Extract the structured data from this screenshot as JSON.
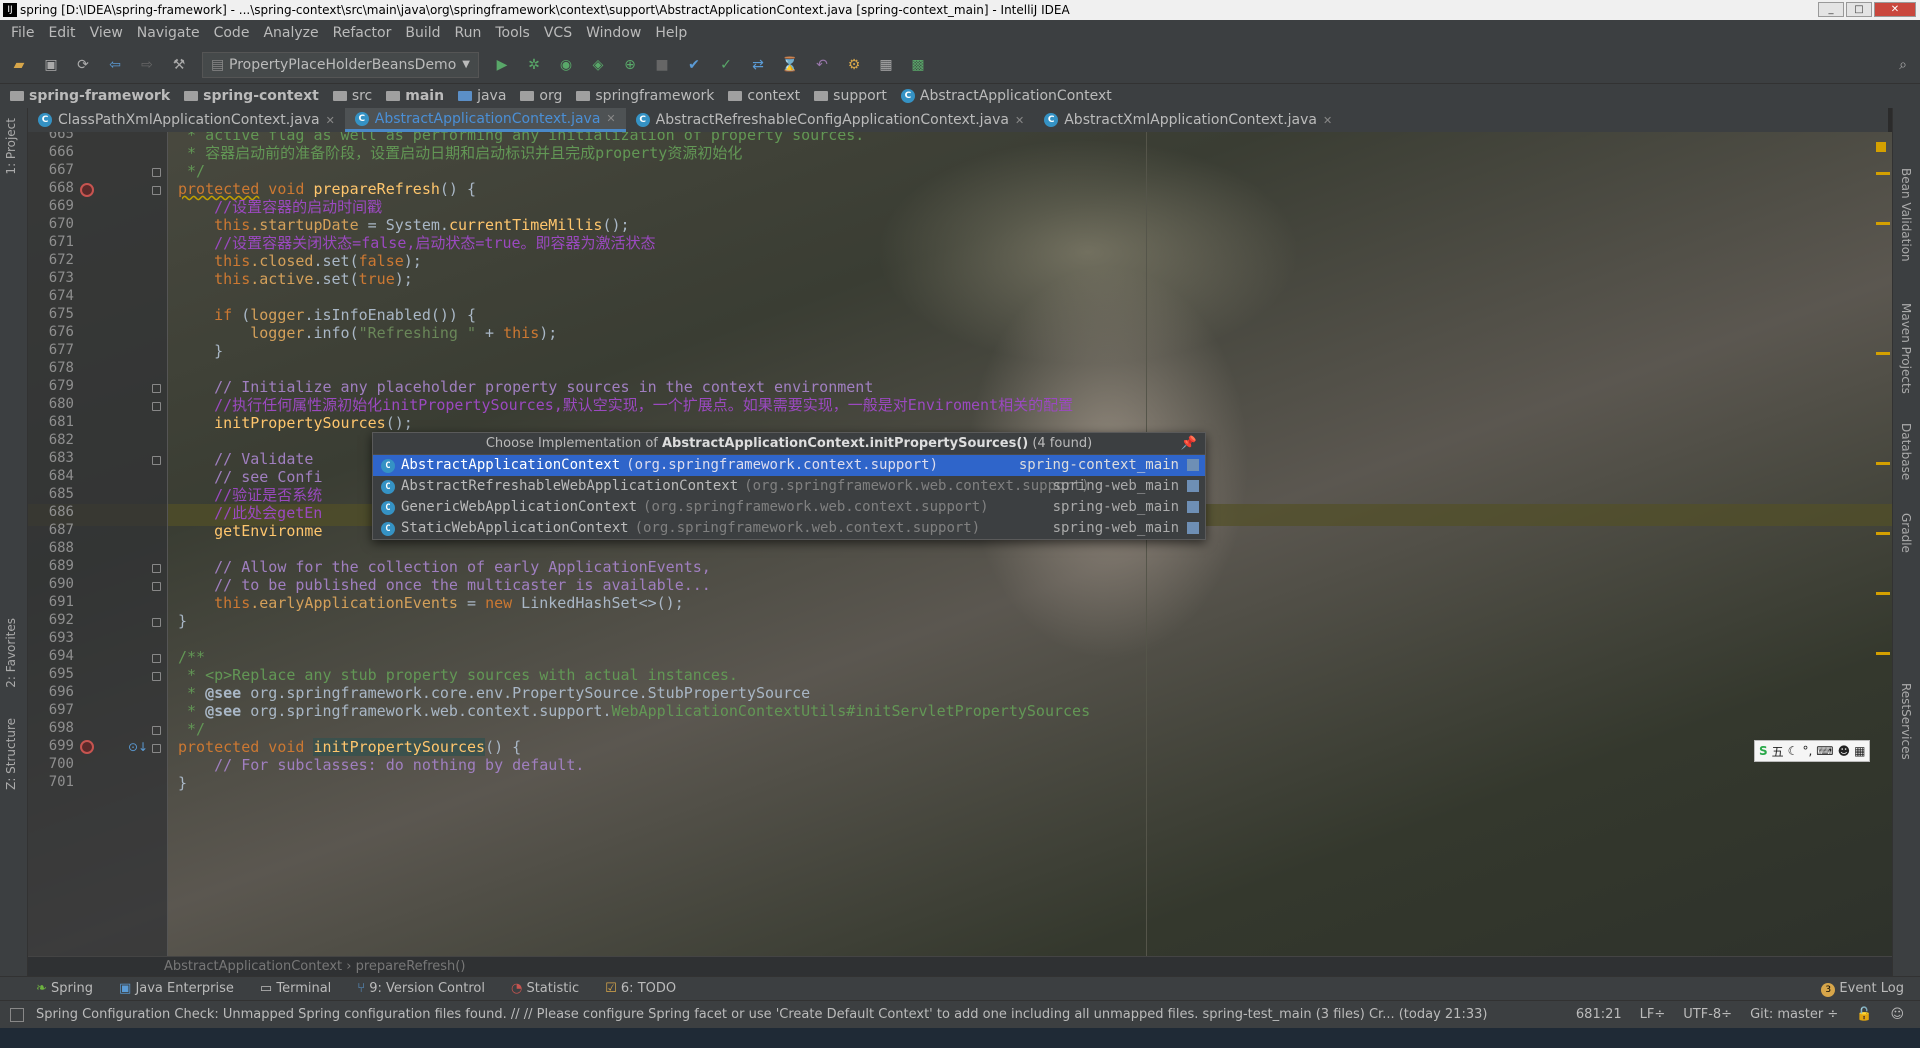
{
  "window": {
    "title": "spring [D:\\IDEA\\spring-framework] - ...\\spring-context\\src\\main\\java\\org\\springframework\\context\\support\\AbstractApplicationContext.java [spring-context_main] - IntelliJ IDEA"
  },
  "menu": [
    "File",
    "Edit",
    "View",
    "Navigate",
    "Code",
    "Analyze",
    "Refactor",
    "Build",
    "Run",
    "Tools",
    "VCS",
    "Window",
    "Help"
  ],
  "toolbar": {
    "run_config": "PropertyPlaceHolderBeansDemo"
  },
  "breadcrumbs": [
    "spring-framework",
    "spring-context",
    "src",
    "main",
    "java",
    "org",
    "springframework",
    "context",
    "support",
    "AbstractApplicationContext"
  ],
  "tabs": [
    "ClassPathXmlApplicationContext.java",
    "AbstractApplicationContext.java",
    "AbstractRefreshableConfigApplicationContext.java",
    "AbstractXmlApplicationContext.java"
  ],
  "left_tools": [
    "1: Project",
    "2: Favorites",
    "Z: Structure"
  ],
  "right_tools": [
    "Bean Validation",
    "Maven Projects",
    "Database",
    "Gradle",
    "RestServices"
  ],
  "line_numbers": [
    "665",
    "666",
    "667",
    "668",
    "669",
    "670",
    "671",
    "672",
    "673",
    "674",
    "675",
    "676",
    "677",
    "678",
    "679",
    "680",
    "681",
    "682",
    "683",
    "684",
    "685",
    "686",
    "687",
    "688",
    "689",
    "690",
    "691",
    "692",
    "693",
    "694",
    "695",
    "696",
    "697",
    "698",
    "699",
    "700",
    "701"
  ],
  "code": {
    "l665": " * active flag as well as performing any initialization of property sources.",
    "l666": " * 容器启动前的准备阶段，设置启动日期和启动标识并且完成property资源初始化",
    "l667": " */",
    "l668_kw": "protected",
    "l668_kw2": " void ",
    "l668_m": "prepareRefresh",
    "l668_rest": "() {",
    "l669": "    //设置容器的启动时间戳",
    "l670_a": "    this",
    "l670_b": ".startupDate",
    "l670_c": " = System.",
    "l670_d": "currentTimeMillis",
    "l670_e": "();",
    "l671": "    //设置容器关闭状态=false,启动状态=true。即容器为激活状态",
    "l672_a": "    this",
    "l672_b": ".closed",
    "l672_c": ".set(",
    "l672_d": "false",
    "l672_e": ");",
    "l673_a": "    this",
    "l673_b": ".active",
    "l673_c": ".set(",
    "l673_d": "true",
    "l673_e": ");",
    "l675_a": "    if",
    "l675_b": " (",
    "l675_c": "logger",
    "l675_d": ".isInfoEnabled()) {",
    "l676_a": "        logger",
    "l676_b": ".info(",
    "l676_c": "\"Refreshing \"",
    "l676_d": " + ",
    "l676_e": "this",
    "l676_f": ");",
    "l677": "    }",
    "l679": "    // Initialize any placeholder property sources in the context environment",
    "l680": "    //执行任何属性源初始化initPropertySources,默认空实现，一个扩展点。如果需要实现，一般是对Enviroment相关的配置",
    "l681_a": "    initPropertySources",
    "l681_b": "();",
    "l683": "    // Validate",
    "l684": "    // see Confi",
    "l685": "    //验证是否系统",
    "l686": "    //此处会getEn",
    "l687": "    getEnvironme",
    "l689": "    // Allow for the collection of early ApplicationEvents,",
    "l690": "    // to be published once the multicaster is available...",
    "l691_a": "    this",
    "l691_b": ".earlyApplicationEvents",
    "l691_c": " = ",
    "l691_d": "new",
    "l691_e": " LinkedHashSet<>();",
    "l692": "}",
    "l694": "/**",
    "l695": " * <p>Replace any stub property sources with actual instances.",
    "l696_a": " * ",
    "l696_b": "@see",
    "l696_c": " org.springframework.core.env.PropertySource.StubPropertySource",
    "l697_a": " * ",
    "l697_b": "@see",
    "l697_c": " org.springframework.web.context.support.",
    "l697_d": "WebApplicationContextUtils#initServletPropertySources",
    "l698": " */",
    "l699_kw": "protected",
    "l699_kw2": " void ",
    "l699_m": "initPropertySources",
    "l699_rest": "() {",
    "l700": "    // For subclasses: do nothing by default.",
    "l701": "}"
  },
  "popup": {
    "title_prefix": "Choose Implementation of ",
    "title_method": "AbstractApplicationContext.initPropertySources()",
    "title_suffix": " (4 found)",
    "items": [
      {
        "name": "AbstractApplicationContext",
        "pkg": "(org.springframework.context.support)",
        "module": "spring-context_main"
      },
      {
        "name": "AbstractRefreshableWebApplicationContext",
        "pkg": "(org.springframework.web.context.support)",
        "module": "spring-web_main"
      },
      {
        "name": "GenericWebApplicationContext",
        "pkg": "(org.springframework.web.context.support)",
        "module": "spring-web_main"
      },
      {
        "name": "StaticWebApplicationContext",
        "pkg": "(org.springframework.web.context.support)",
        "module": "spring-web_main"
      }
    ]
  },
  "editor_breadcrumb": {
    "class": "AbstractApplicationContext",
    "sep": " › ",
    "method": "prepareRefresh()"
  },
  "tool_windows": [
    "Spring",
    "Java Enterprise",
    "Terminal",
    "9: Version Control",
    "Statistic",
    "6: TODO"
  ],
  "event_log": "Event Log",
  "event_count": "3",
  "status": {
    "message": "Spring Configuration Check: Unmapped Spring configuration files found. // // Please configure Spring facet or use 'Create Default Context' to add one including all unmapped files. spring-test_main (3 files)   Cr... (today 21:33)",
    "position": "681:21",
    "line_sep": "LF÷",
    "encoding": "UTF-8÷",
    "git": "Git: master ÷"
  },
  "ime": {
    "label": "五"
  }
}
